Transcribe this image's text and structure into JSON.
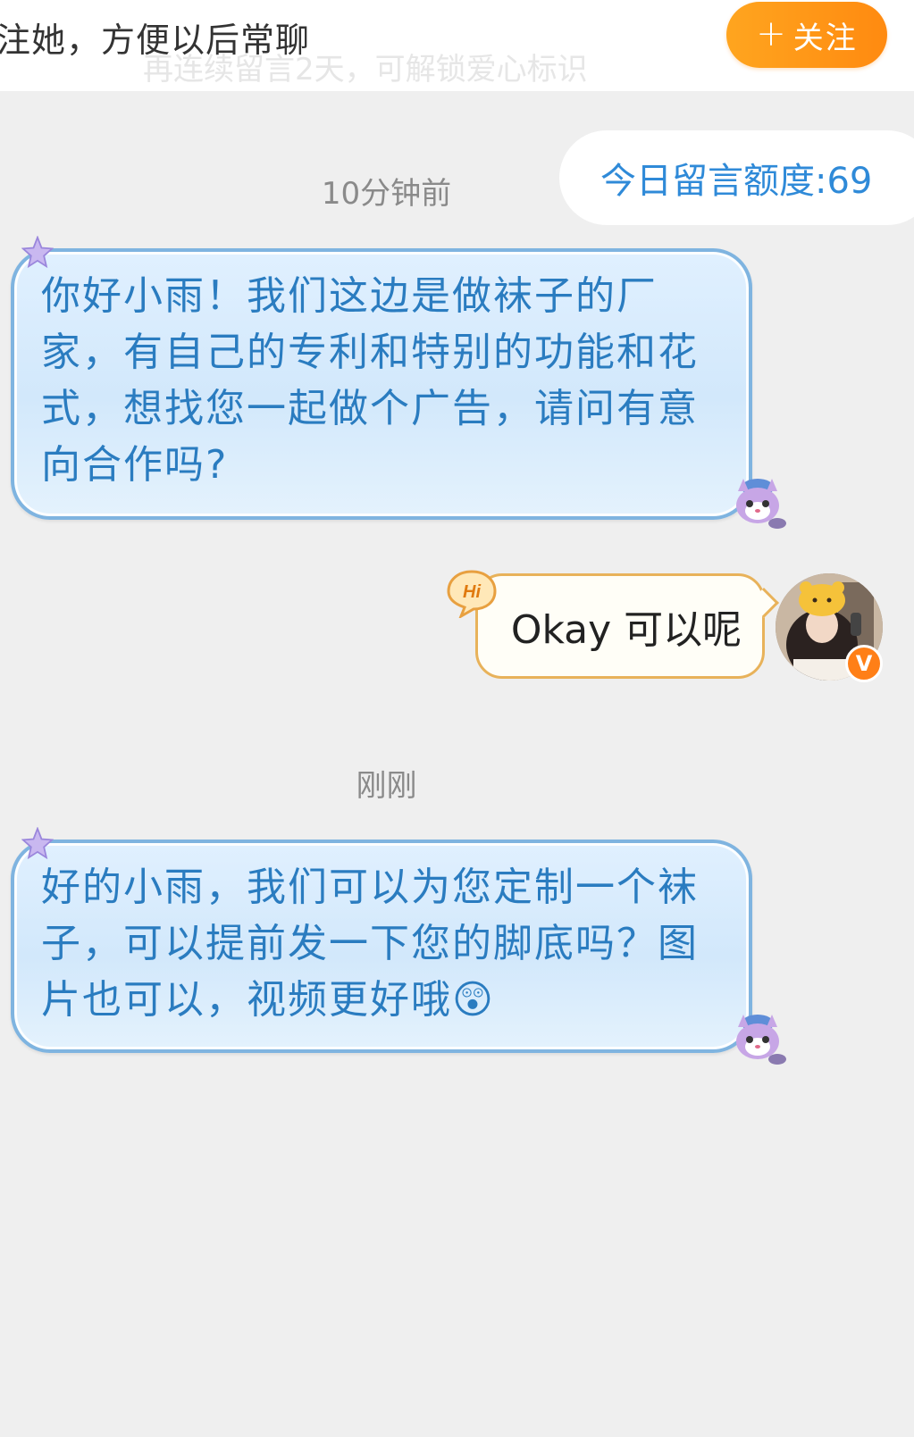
{
  "header": {
    "prompt_text": "注她，方便以后常聊",
    "ghost_text": "再连续留言2天，可解锁爱心标识",
    "follow_label": "关注",
    "follow_plus": "+"
  },
  "quota": {
    "label": "今日留言额度:69"
  },
  "messages": [
    {
      "timestamp": "10分钟前",
      "direction": "incoming",
      "text": "你好小雨！我们这边是做袜子的厂家，有自己的专利和特别的功能和花式，想找您一起做个广告，请问有意向合作吗?"
    },
    {
      "direction": "outgoing",
      "badge": "Hi",
      "text": "Okay 可以呢"
    },
    {
      "timestamp": "刚刚",
      "direction": "incoming",
      "text": "好的小雨，我们可以为您定制一个袜子，可以提前发一下您的脚底吗？图片也可以，视频更好哦",
      "emoji": "😲"
    }
  ],
  "avatar": {
    "verified_badge": "V"
  },
  "colors": {
    "follow_button": "#ff9a18",
    "incoming_text": "#2a7cc0",
    "incoming_border": "#7fb4e0",
    "outgoing_border": "#e8b25a",
    "quota_text": "#2f8ad8",
    "verified_badge": "#ff7f17"
  },
  "icons": [
    "star-sticker-icon",
    "cat-sticker-icon",
    "hi-badge-icon",
    "verified-v-icon",
    "surprised-emoji-icon"
  ]
}
